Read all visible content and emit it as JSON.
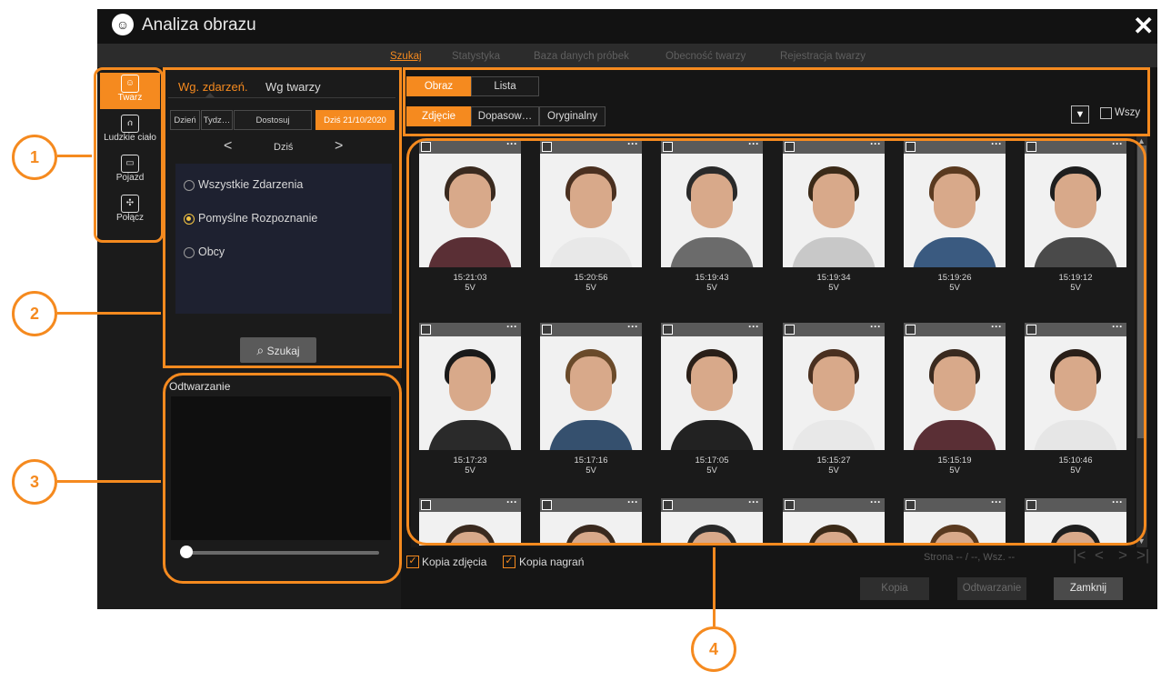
{
  "window": {
    "title": "Analiza obrazu",
    "close_glyph": "✕"
  },
  "topnav": {
    "tabs": [
      {
        "label": "Szukaj",
        "active": true
      },
      {
        "label": "Statystyka"
      },
      {
        "label": "Baza danych próbek"
      },
      {
        "label": "Obecność twarzy"
      },
      {
        "label": "Rejestracja twarzy"
      }
    ]
  },
  "sidebar": {
    "items": [
      {
        "label": "Twarz",
        "icon": "face-icon",
        "active": true
      },
      {
        "label": "Ludzkie ciało",
        "icon": "person-icon"
      },
      {
        "label": "Pojazd",
        "icon": "car-icon"
      },
      {
        "label": "Połącz",
        "icon": "puzzle-icon"
      }
    ]
  },
  "search": {
    "subtabs": [
      "Wg. zdarzeń.",
      "Wg twarzy"
    ],
    "date_buttons": [
      "Dzień",
      "Tydz…",
      "Dostosuj",
      "Dziś 21/10/2020"
    ],
    "nav": {
      "prev": "<",
      "current": "Dziś",
      "next": ">"
    },
    "radio": [
      "Wszystkie Zdarzenia",
      "Pomyślne Rozpoznanie",
      "Obcy"
    ],
    "selected_radio": 1,
    "search_button": "Szukaj"
  },
  "playback": {
    "label": "Odtwarzanie",
    "position": 0
  },
  "results": {
    "view_modes": [
      "Obraz",
      "Lista"
    ],
    "image_modes": [
      "Zdjęcie",
      "Dopasow…",
      "Oryginalny"
    ],
    "select_all_label": "Wszy",
    "items": [
      {
        "time": "15:21:03",
        "channel": "5V",
        "hair": "#3a2a1f",
        "shirt": "#5a2f35"
      },
      {
        "time": "15:20:56",
        "channel": "5V",
        "hair": "#4a3020",
        "shirt": "#e8e8e8"
      },
      {
        "time": "15:19:43",
        "channel": "5V",
        "hair": "#2a2a2a",
        "shirt": "#6b6b6b"
      },
      {
        "time": "15:19:34",
        "channel": "5V",
        "hair": "#3b2a18",
        "shirt": "#c8c8c8"
      },
      {
        "time": "15:19:26",
        "channel": "5V",
        "hair": "#5a3a20",
        "shirt": "#3a5a80"
      },
      {
        "time": "15:19:12",
        "channel": "5V",
        "hair": "#1e1e1e",
        "shirt": "#4a4a4a"
      },
      {
        "time": "15:17:23",
        "channel": "5V",
        "hair": "#1a1a1a",
        "shirt": "#2a2a2a"
      },
      {
        "time": "15:17:16",
        "channel": "5V",
        "hair": "#6a4a2a",
        "shirt": "#35506e"
      },
      {
        "time": "15:17:05",
        "channel": "5V",
        "hair": "#2a1f18",
        "shirt": "#222222"
      },
      {
        "time": "15:15:27",
        "channel": "5V",
        "hair": "#4a3020",
        "shirt": "#e8e8e8"
      },
      {
        "time": "15:15:19",
        "channel": "5V",
        "hair": "#3a2a1f",
        "shirt": "#5a2f35"
      },
      {
        "time": "15:10:46",
        "channel": "5V",
        "hair": "#2a1f18",
        "shirt": "#e6e6e6"
      },
      {
        "time": "",
        "channel": "",
        "hair": "#3a2a1f",
        "shirt": "#5a2f35"
      },
      {
        "time": "",
        "channel": "",
        "hair": "#3a2a1f",
        "shirt": "#e8e8e8"
      },
      {
        "time": "",
        "channel": "",
        "hair": "#2a2a2a",
        "shirt": "#6b6b6b"
      },
      {
        "time": "",
        "channel": "",
        "hair": "#3b2a18",
        "shirt": "#c8c8c8"
      },
      {
        "time": "",
        "channel": "",
        "hair": "#5a3a20",
        "shirt": "#3a5a80"
      },
      {
        "time": "",
        "channel": "",
        "hair": "#1e1e1e",
        "shirt": "#4a4a4a"
      }
    ]
  },
  "footer": {
    "copy_photo": "Kopia zdjęcia",
    "copy_recording": "Kopia nagrań",
    "page_info": "Strona -- / --, Wsz. --",
    "buttons": [
      "Kopia",
      "Odtwarzanie",
      "Zamknij"
    ]
  },
  "callouts": [
    "1",
    "2",
    "3",
    "4"
  ],
  "colors": {
    "accent": "#f58a1f",
    "window_bg": "#151515",
    "panel_bg": "#1b1b1b"
  }
}
